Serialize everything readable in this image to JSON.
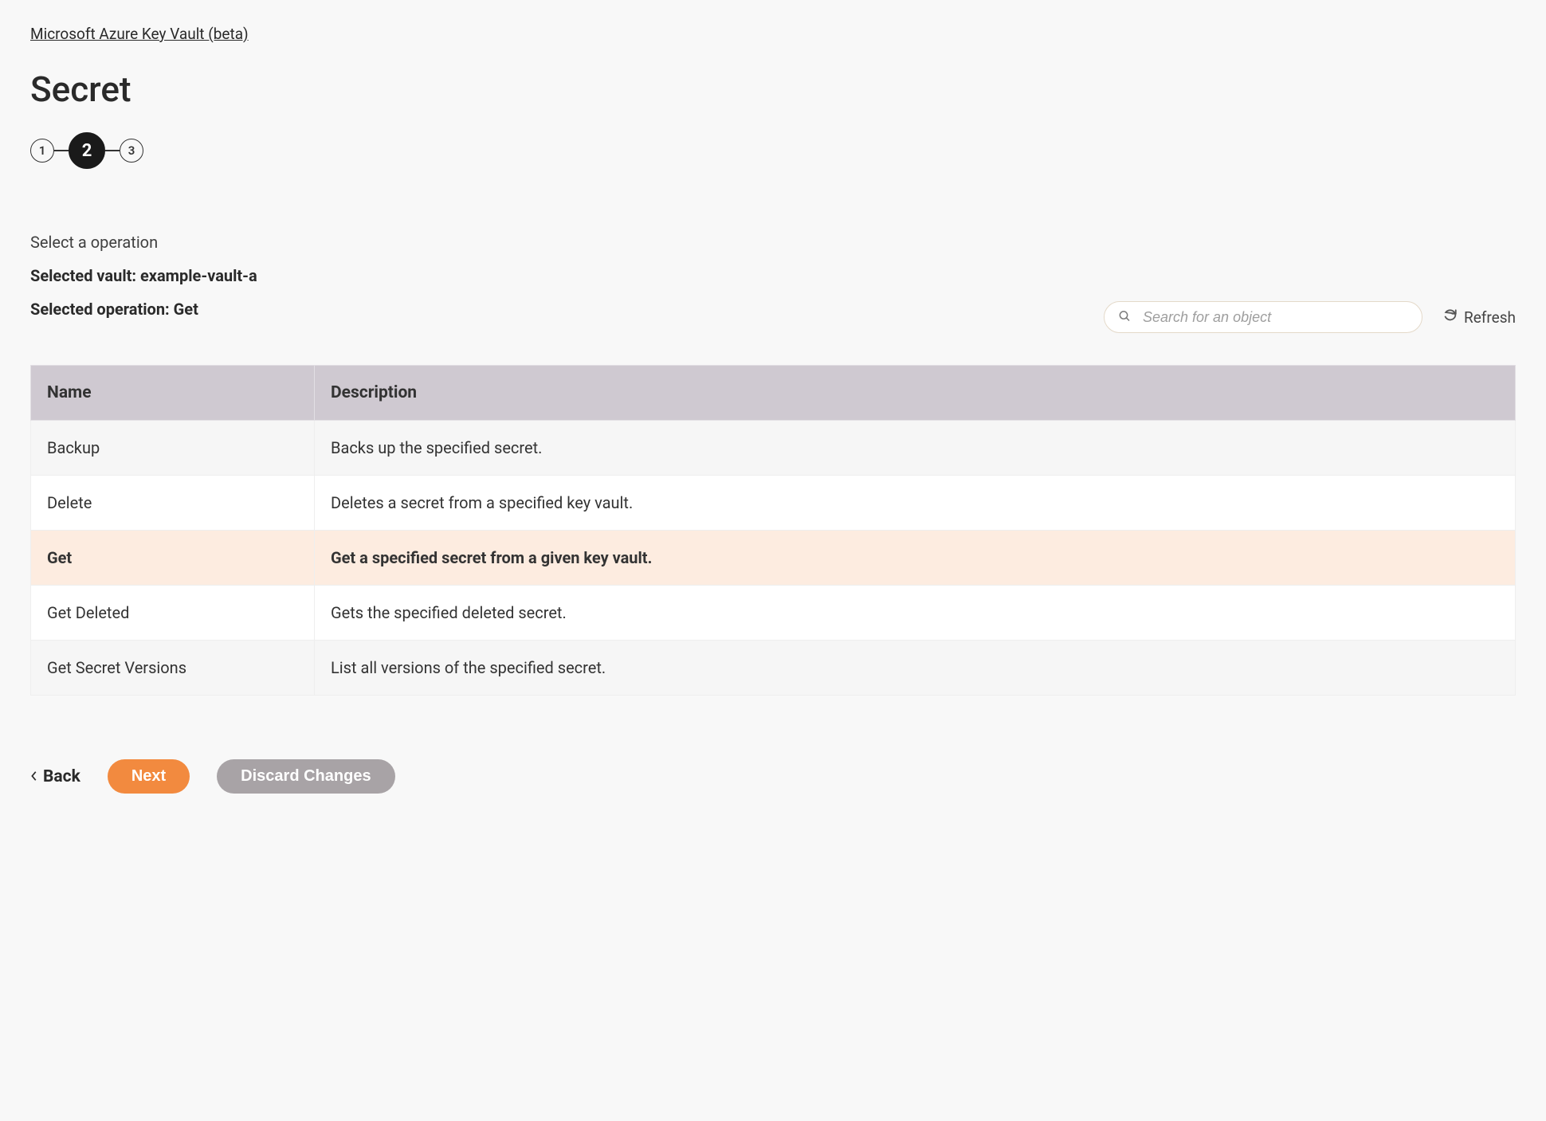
{
  "breadcrumb": "Microsoft Azure Key Vault (beta)",
  "title": "Secret",
  "stepper": {
    "steps": [
      "1",
      "2",
      "3"
    ],
    "active_index": 1
  },
  "subheading": "Select a operation",
  "selected_vault_label": "Selected vault: example-vault-a",
  "selected_operation_label": "Selected operation: Get",
  "search": {
    "placeholder": "Search for an object"
  },
  "refresh_label": "Refresh",
  "table": {
    "columns": [
      "Name",
      "Description"
    ],
    "rows": [
      {
        "name": "Backup",
        "description": "Backs up the specified secret.",
        "selected": false
      },
      {
        "name": "Delete",
        "description": "Deletes a secret from a specified key vault.",
        "selected": false
      },
      {
        "name": "Get",
        "description": "Get a specified secret from a given key vault.",
        "selected": true
      },
      {
        "name": "Get Deleted",
        "description": "Gets the specified deleted secret.",
        "selected": false
      },
      {
        "name": "Get Secret Versions",
        "description": "List all versions of the specified secret.",
        "selected": false
      }
    ]
  },
  "footer": {
    "back": "Back",
    "next": "Next",
    "discard": "Discard Changes"
  }
}
